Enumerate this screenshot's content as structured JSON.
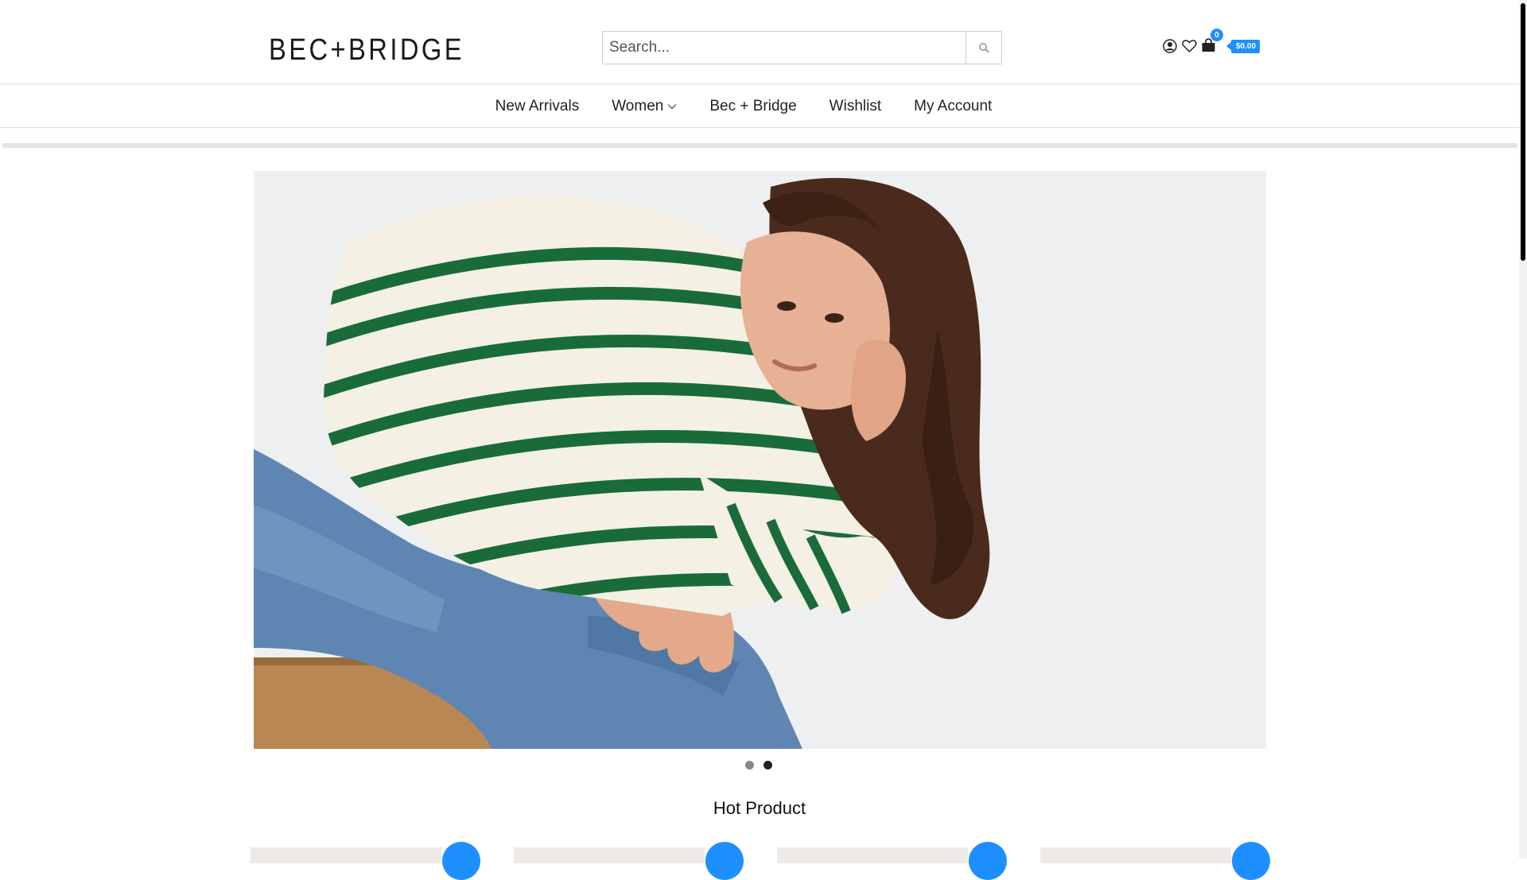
{
  "header": {
    "logo_text": "BEC+BRIDGE",
    "search_placeholder": "Search...",
    "account_icon": "user-circle-icon",
    "wishlist_icon": "heart-icon",
    "cart_icon": "shopping-bag-icon",
    "cart_count": "0",
    "cart_total": "$0.00"
  },
  "nav": {
    "items": [
      {
        "label": "New Arrivals"
      },
      {
        "label": "Women",
        "has_dropdown": true
      },
      {
        "label": "Bec + Bridge"
      },
      {
        "label": "Wishlist"
      },
      {
        "label": "My Account"
      }
    ]
  },
  "slider": {
    "total_slides": 2,
    "active_slide": 2
  },
  "hot_product": {
    "title": "Hot Product"
  },
  "colors": {
    "accent": "#1e8fff",
    "stripe_green": "#1a6b3a",
    "sweater_cream": "#f4f0e4",
    "denim": "#5a7fa8"
  }
}
